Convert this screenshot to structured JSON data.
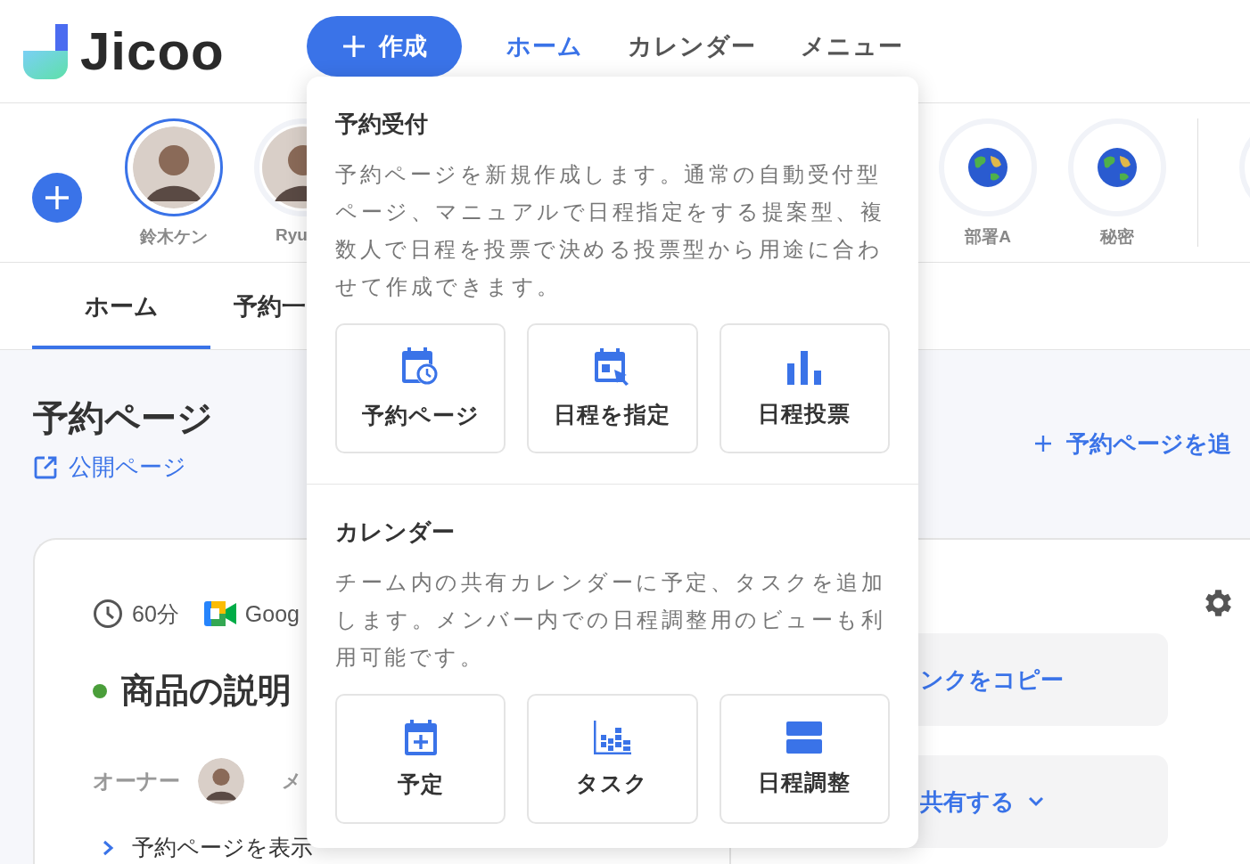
{
  "header": {
    "logo": "Jicoo",
    "create_button": "作成",
    "nav": [
      {
        "label": "ホーム",
        "selected": true
      },
      {
        "label": "カレンダー",
        "selected": false
      },
      {
        "label": "メニュー",
        "selected": false
      }
    ]
  },
  "members": [
    {
      "name": "鈴木ケン",
      "kind": "person",
      "selected": true
    },
    {
      "name": "Ryu",
      "kind": "person",
      "selected": false
    },
    {
      "name": "部署A",
      "kind": "globe",
      "selected": false
    },
    {
      "name": "秘密",
      "kind": "globe",
      "selected": false
    }
  ],
  "tabs": [
    {
      "label": "ホーム",
      "selected": true
    },
    {
      "label": "予約一",
      "selected": false
    }
  ],
  "page": {
    "title": "予約ページ",
    "public_link": "公開ページ",
    "add_link": "予約ページを追"
  },
  "card": {
    "duration": "60分",
    "location": "Goog",
    "title": "商品の説明",
    "status_dot": {
      "color": "#4a9e3a"
    },
    "owner_label": "オーナー",
    "column_2": "メ",
    "view_link": "予約ページを表示",
    "buttons": [
      "ンクをコピー",
      "共有する"
    ]
  },
  "create_menu": [
    {
      "title": "予約受付",
      "description": "予約ページを新規作成します。通常の自動受付型ページ、マニュアルで日程指定をする提案型、複数人で日程を投票で決める投票型から用途に合わせて作成できます。",
      "items": [
        {
          "label": "予約ページ",
          "kind": "booking"
        },
        {
          "label": "日程を指定",
          "kind": "specify"
        },
        {
          "label": "日程投票",
          "kind": "poll"
        }
      ]
    },
    {
      "title": "カレンダー",
      "description": "チーム内の共有カレンダーに予定、タスクを追加します。メンバー内での日程調整用のビューも利用可能です。",
      "items": [
        {
          "label": "予定",
          "kind": "event"
        },
        {
          "label": "タスク",
          "kind": "task"
        },
        {
          "label": "日程調整",
          "kind": "adjust"
        }
      ]
    }
  ]
}
